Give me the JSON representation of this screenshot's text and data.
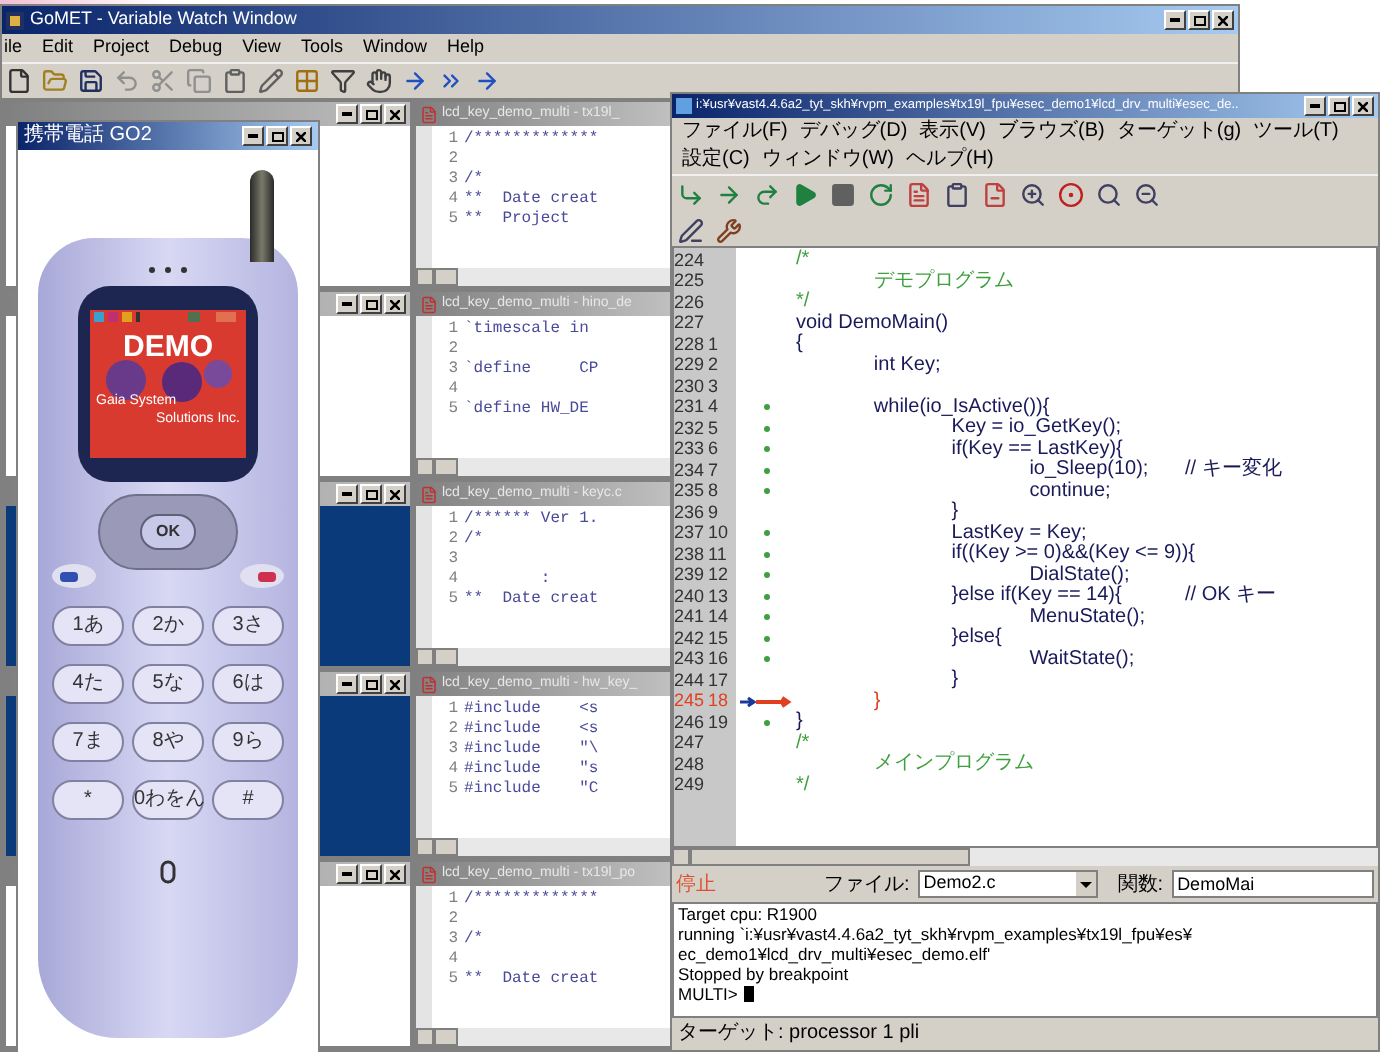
{
  "main_window": {
    "title": "GoMET - Variable Watch Window",
    "menu": [
      "ile",
      "Edit",
      "Project",
      "Debug",
      "View",
      "Tools",
      "Window",
      "Help"
    ]
  },
  "side_panes": [
    {
      "filled": false
    },
    {
      "filled": false
    },
    {
      "filled": true
    },
    {
      "filled": true
    },
    {
      "filled": false
    }
  ],
  "editor_panes": [
    {
      "title": "lcd_key_demo_multi - tx19l_",
      "lines": [
        {
          "number": "1",
          "text": "/*************"
        },
        {
          "number": "2"
        },
        {
          "number": "3",
          "text": "/*"
        },
        {
          "number": "4",
          "text": "**  Date creat"
        },
        {
          "number": "5",
          "text": "**  Project"
        }
      ]
    },
    {
      "title": "lcd_key_demo_multi - hino_de",
      "lines": [
        {
          "number": "1",
          "text": "`timescale in"
        },
        {
          "number": "2"
        },
        {
          "number": "3",
          "text": "`define     CP"
        },
        {
          "number": "4"
        },
        {
          "number": "5",
          "text": "`define HW_DE"
        }
      ]
    },
    {
      "title": "lcd_key_demo_multi - keyc.c",
      "lines": [
        {
          "number": "1",
          "text": "/****** Ver 1."
        },
        {
          "number": "2",
          "text": "/*"
        },
        {
          "number": "3"
        },
        {
          "number": "4",
          "text": "        :"
        },
        {
          "number": "5",
          "text": "**  Date creat"
        }
      ]
    },
    {
      "title": "lcd_key_demo_multi - hw_key_",
      "lines": [
        {
          "number": "1",
          "text": "#include    <s"
        },
        {
          "number": "2",
          "text": "#include    <s"
        },
        {
          "number": "3",
          "text": "#include    \"\\"
        },
        {
          "number": "4",
          "text": "#include    \"s"
        },
        {
          "number": "5",
          "text": "#include    \"C"
        }
      ]
    },
    {
      "title": "lcd_key_demo_multi - tx19l_po",
      "lines": [
        {
          "number": "1",
          "text": "/*************"
        },
        {
          "number": "2"
        },
        {
          "number": "3",
          "text": "/*"
        },
        {
          "number": "4"
        },
        {
          "number": "5",
          "text": "**  Date creat"
        }
      ]
    }
  ],
  "phone_window": {
    "title": "携帯電話 GO2",
    "logo": "DEMO",
    "company": [
      "Gaia System",
      "Solutions Inc."
    ],
    "nav_key": "OK",
    "keys": [
      "1あ",
      "2か",
      "3さ",
      "4た",
      "5な",
      "6は",
      "7ま",
      "8や",
      "9ら",
      "*",
      "0わをん",
      "#"
    ]
  },
  "debugger_window": {
    "title": "i:¥usr¥vast4.4.6a2_tyt_skh¥rvpm_examples¥tx19l_fpu¥esec_demo1¥lcd_drv_multi¥esec_de..",
    "menu": [
      "ファイル(F)",
      "デバッグ(D)",
      "表示(V)",
      "ブラウズ(B)",
      "ターゲット(g)",
      "ツール(T)",
      "設定(C)",
      "ウィンドウ(W)",
      "ヘルプ(H)"
    ],
    "code_lines": [
      {
        "line": "224",
        "dot": false,
        "current": false,
        "kind": "comment",
        "text": "/*"
      },
      {
        "line": "225",
        "dot": false,
        "current": false,
        "kind": "comment",
        "text": "\tデモプログラム"
      },
      {
        "line": "226",
        "dot": false,
        "current": false,
        "kind": "comment",
        "text": "*/"
      },
      {
        "line": "227",
        "dot": false,
        "current": false,
        "kind": "code",
        "text": "void DemoMain()"
      },
      {
        "line": "228",
        "local": "1",
        "dot": false,
        "current": false,
        "kind": "code",
        "text": "{"
      },
      {
        "line": "229",
        "local": "2",
        "dot": false,
        "current": false,
        "kind": "code",
        "text": "\tint Key;"
      },
      {
        "line": "230",
        "local": "3",
        "dot": false,
        "current": false
      },
      {
        "line": "231",
        "local": "4",
        "dot": true,
        "current": false,
        "kind": "code",
        "text": "\twhile(io_IsActive()){"
      },
      {
        "line": "232",
        "local": "5",
        "dot": true,
        "current": false,
        "kind": "code",
        "text": "\t\tKey = io_GetKey();"
      },
      {
        "line": "233",
        "local": "6",
        "dot": true,
        "current": false,
        "kind": "code",
        "text": "\t\tif(Key == LastKey){"
      },
      {
        "line": "234",
        "local": "7",
        "dot": true,
        "current": false,
        "kind": "code",
        "text": "\t\t\tio_Sleep(10);\t// キー変化"
      },
      {
        "line": "235",
        "local": "8",
        "dot": true,
        "current": false,
        "kind": "code",
        "text": "\t\t\tcontinue;"
      },
      {
        "line": "236",
        "local": "9",
        "dot": false,
        "current": false,
        "kind": "code",
        "text": "\t\t}"
      },
      {
        "line": "237",
        "local": "10",
        "dot": true,
        "current": false,
        "kind": "code",
        "text": "\t\tLastKey = Key;"
      },
      {
        "line": "238",
        "local": "11",
        "dot": true,
        "current": false,
        "kind": "code",
        "text": "\t\tif((Key >= 0)&&(Key <= 9)){"
      },
      {
        "line": "239",
        "local": "12",
        "dot": true,
        "current": false,
        "kind": "code",
        "text": "\t\t\tDialState();"
      },
      {
        "line": "240",
        "local": "13",
        "dot": true,
        "current": false,
        "kind": "code",
        "text": "\t\t}else if(Key == 14){\t// OK キー"
      },
      {
        "line": "241",
        "local": "14",
        "dot": true,
        "current": false,
        "kind": "code",
        "text": "\t\t\tMenuState();"
      },
      {
        "line": "242",
        "local": "15",
        "dot": true,
        "current": false,
        "kind": "code",
        "text": "\t\t}else{"
      },
      {
        "line": "243",
        "local": "16",
        "dot": true,
        "current": false,
        "kind": "code",
        "text": "\t\t\tWaitState();"
      },
      {
        "line": "244",
        "local": "17",
        "dot": false,
        "current": false,
        "kind": "code",
        "text": "\t\t}"
      },
      {
        "line": "245",
        "local": "18",
        "dot": false,
        "current": true,
        "kind": "code",
        "text": "\t}"
      },
      {
        "line": "246",
        "local": "19",
        "dot": true,
        "current": false,
        "kind": "code",
        "text": "}"
      },
      {
        "line": "247",
        "dot": false,
        "current": false,
        "kind": "comment",
        "text": "/*"
      },
      {
        "line": "248",
        "dot": false,
        "current": false,
        "kind": "comment",
        "text": "\tメインプログラム"
      },
      {
        "line": "249",
        "dot": false,
        "current": false,
        "kind": "comment",
        "text": "*/"
      }
    ],
    "status": {
      "state": "停止",
      "file_label": "ファイル:",
      "file": "Demo2.c",
      "function_label": "関数:",
      "function": "DemoMai"
    },
    "console": [
      "Target cpu: R1900",
      "running `i:¥usr¥vast4.4.6a2_tyt_skh¥rvpm_examples¥tx19l_fpu¥es¥",
      "ec_demo1¥lcd_drv_multi¥esec_demo.elf'",
      "Stopped by breakpoint",
      "MULTI>"
    ],
    "status_bar": "ターゲット: processor 1 pli"
  }
}
